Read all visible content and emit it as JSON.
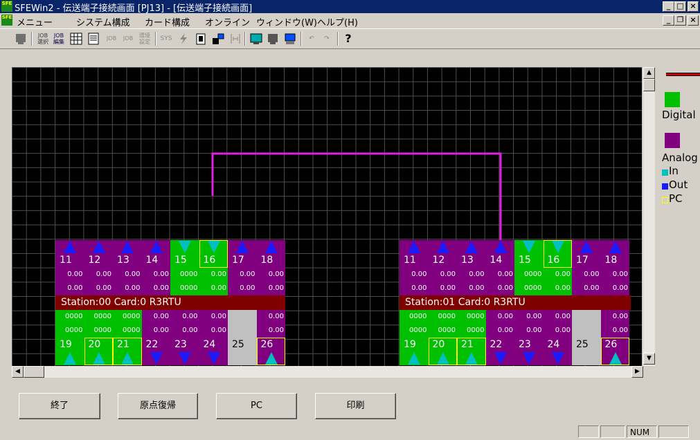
{
  "window": {
    "title": "SFEWin2 - 伝送端子接続画面 [PJ13] - [伝送端子接続画面]",
    "app_icon": "SFE"
  },
  "menu": {
    "items": [
      "メニュー",
      "システム構成",
      "カード構成",
      "オンライン",
      "ウィンドウ(W)",
      "ヘルプ(H)"
    ]
  },
  "toolbar": {
    "labels": [
      "JOB選択",
      "JOB編集",
      "JOB",
      "JOB",
      "環境設定",
      "SYS"
    ]
  },
  "legend": {
    "digital": "Digital",
    "analog": "Analog",
    "in": "In",
    "out": "Out",
    "pc": "PC"
  },
  "stations": [
    {
      "label": "Station:00   Card:0  R3RTU",
      "top_nums": [
        "11",
        "12",
        "13",
        "14",
        "15",
        "16",
        "17",
        "18"
      ],
      "top_row1": [
        "0.00",
        "0.00",
        "0.00",
        "0.00",
        "0000",
        "0.00",
        "0.00",
        "0.00"
      ],
      "top_row2": [
        "0.00",
        "0.00",
        "0.00",
        "0.00",
        "0000",
        "0.00",
        "0.00",
        "0.00"
      ],
      "bot_row1": [
        "0000",
        "0000",
        "0000",
        "0.00",
        "0.00",
        "0.00",
        "",
        "0.00"
      ],
      "bot_row2": [
        "0000",
        "0000",
        "0000",
        "0.00",
        "0.00",
        "0.00",
        "",
        "0.00"
      ],
      "bot_nums": [
        "19",
        "20",
        "21",
        "22",
        "23",
        "24",
        "25",
        "26"
      ]
    },
    {
      "label": "Station:01   Card:0  R3RTU",
      "top_nums": [
        "11",
        "12",
        "13",
        "14",
        "15",
        "16",
        "17",
        "18"
      ],
      "top_row1": [
        "0.00",
        "0.00",
        "0.00",
        "0.00",
        "0000",
        "0.00",
        "0.00",
        "0.00"
      ],
      "top_row2": [
        "0.00",
        "0.00",
        "0.00",
        "0.00",
        "0000",
        "0.00",
        "0.00",
        "0.00"
      ],
      "bot_row1": [
        "0000",
        "0000",
        "0000",
        "0.00",
        "0.00",
        "0.00",
        "",
        "0.00"
      ],
      "bot_row2": [
        "0000",
        "0000",
        "0000",
        "0.00",
        "0.00",
        "0.00",
        "",
        "0.00"
      ],
      "bot_nums": [
        "19",
        "20",
        "21",
        "22",
        "23",
        "24",
        "25",
        "26"
      ]
    }
  ],
  "buttons": {
    "exit": "終了",
    "restore": "原点復帰",
    "pc": "PC",
    "print": "印刷"
  },
  "status": {
    "num": "NUM"
  },
  "colors": {
    "digital": "#00c000",
    "analog": "#800080",
    "in": "#00c0c0",
    "out": "#1a1aff",
    "pc": "#ffff00",
    "station_band": "#800000",
    "wire": "#e020e0"
  }
}
